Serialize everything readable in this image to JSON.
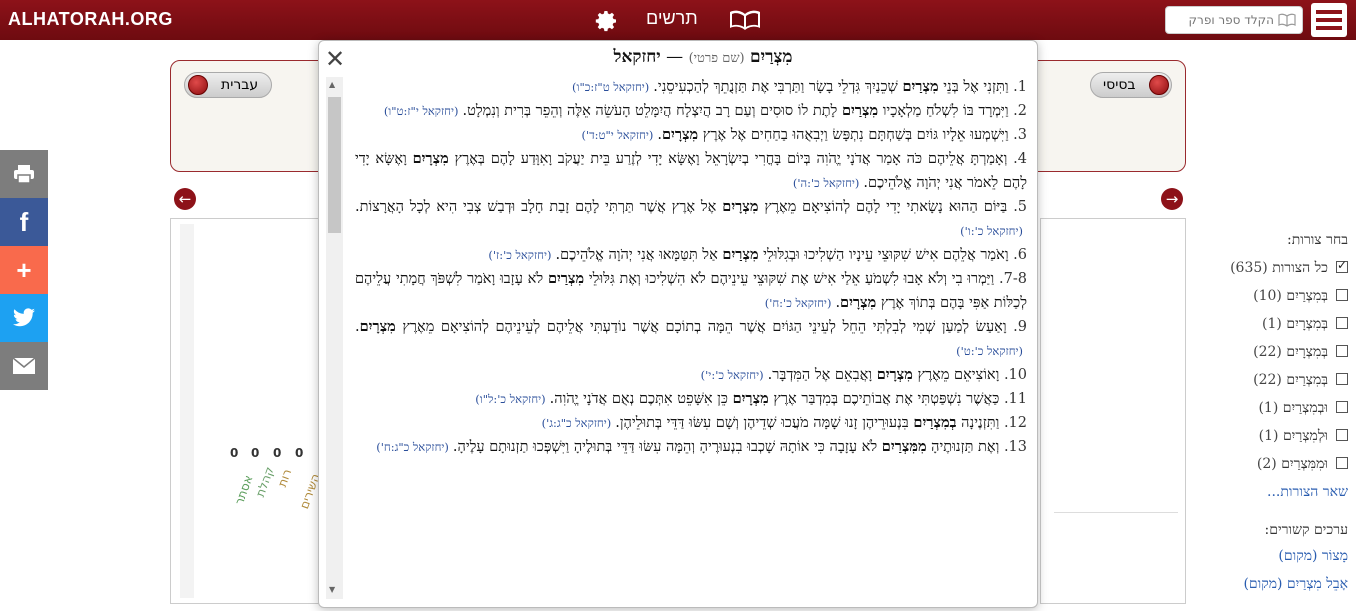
{
  "header": {
    "logo": "ALHATORAH.ORG",
    "nav_title": "תרשים",
    "search_placeholder": "הקלד ספר ופרק",
    "icons": [
      "gear-icon",
      "book-icon",
      "menu-icon"
    ]
  },
  "share": [
    "print-icon",
    "facebook-icon",
    "plus-icon",
    "twitter-icon",
    "email-icon"
  ],
  "toggles": {
    "left": "עברית",
    "right": "בסיסי"
  },
  "left_counts": [
    "0",
    "0",
    "0",
    "0"
  ],
  "left_labels": [
    "אסתר",
    "קהלת",
    "רות",
    "השירים"
  ],
  "forms": {
    "title": "בחר צורות:",
    "items": [
      {
        "label": "כל הצורות",
        "count": "(635)",
        "checked": true
      },
      {
        "label": "בְּמִצְרַיִם",
        "count": "(10)",
        "checked": false
      },
      {
        "label": "בְּמִצְרָיִם",
        "count": "(1)",
        "checked": false
      },
      {
        "label": "בְּמִצְרָיִם",
        "count": "(22)",
        "checked": false
      },
      {
        "label": "בְּמִצְרַיִם",
        "count": "(22)",
        "checked": false
      },
      {
        "label": "וּבְמִצְרַיִם",
        "count": "(1)",
        "checked": false
      },
      {
        "label": "וּלְמִצְרַיִם",
        "count": "(1)",
        "checked": false
      },
      {
        "label": "וּמִמִּצְרַיִם",
        "count": "(2)",
        "checked": false
      }
    ],
    "more": "שאר הצורות..."
  },
  "related": {
    "title": "ערכים קשורים:",
    "items": [
      "מָצוֹר (מקום)",
      "אָבֵל מִצְרַיִם (מקום)"
    ]
  },
  "modal": {
    "title_word": "מִצְרַיִם",
    "title_sub": "(שם פרטי)",
    "title_dash": "—",
    "title_book": "יחזקאל",
    "verses": [
      {
        "num": "1.",
        "pre": "וַתִּזְנִי אֶל בְּנֵי ",
        "bold": "מִצְרַיִם",
        "post": " שְׁכֵנַיִךְ גִּדְלֵי בָשָׂר וַתַּרְבִּי אֶת תַּזְנֻתֵךְ לְהַכְעִיסֵנִי.",
        "ref": "(יחזקאל ט\"ז:כ\"ו)"
      },
      {
        "num": "2.",
        "pre": "וַיִּמְרָד בּוֹ לִשְׁלֹחַ מַלְאָכָיו ",
        "bold": "מִצְרַיִם",
        "post": " לָתֶת לוֹ סוּסִים וְעַם רָב הֲיִצְלָח הֲיִמָּלֵט הָעֹשֵׂה אֵלֶּה וְהֵפֵר בְּרִית וְנִמְלָט.",
        "ref": "(יחזקאל י\"ז:ט\"ו)"
      },
      {
        "num": "3.",
        "pre": "וַיִּשְׁמְעוּ אֵלָיו גּוֹיִם בְּשַׁחְתָּם נִתְפָּשׂ וַיְבִאֻהוּ בַחַחִים אֶל אֶרֶץ ",
        "bold": "מִצְרָיִם",
        "post": ".",
        "ref": "(יחזקאל י\"ט:ד')"
      },
      {
        "num": "4.",
        "pre": "וְאָמַרְתָּ אֲלֵיהֶם כֹּה אָמַר אֲדֹנָי יֱהֹוִה בְּיוֹם בָּחֳרִי בְיִשְׂרָאֵל וָאֶשָּׂא יָדִי לְזֶרַע בֵּית יַעֲקֹב וָאִוָּדַע לָהֶם בְּאֶרֶץ ",
        "bold": "מִצְרָיִם",
        "post": " וָאֶשָּׂא יָדִי לָהֶם לֵאמֹר אֲנִי יְהֹוָה אֱלֹהֵיכֶם.",
        "ref": "(יחזקאל כ':ה')"
      },
      {
        "num": "5.",
        "pre": "בַּיּוֹם הַהוּא נָשָׂאתִי יָדִי לָהֶם לְהוֹצִיאָם מֵאֶרֶץ ",
        "bold": "מִצְרָיִם",
        "post": " אֶל אֶרֶץ אֲשֶׁר תַּרְתִּי לָהֶם זָבַת חָלָב וּדְבַשׁ צְבִי הִיא לְכָל הָאֲרָצוֹת.",
        "ref": "(יחזקאל כ':ו')"
      },
      {
        "num": "6.",
        "pre": "וָאֹמַר אֲלֵהֶם אִישׁ שִׁקּוּצֵי עֵינָיו הַשְׁלִיכוּ וּבְגִלּוּלֵי ",
        "bold": "מִצְרַיִם",
        "post": " אַל תִּטַּמָּאוּ אֲנִי יְהֹוָה אֱלֹהֵיכֶם.",
        "ref": "(יחזקאל כ':ז')"
      },
      {
        "num": "7-8.",
        "pre": "וַיַּמְרוּ בִי וְלֹא אָבוּ לִשְׁמֹעַ אֵלַי אִישׁ אֶת שִׁקּוּצֵי עֵינֵיהֶם לֹא הִשְׁלִיכוּ וְאֶת גִּלּוּלֵי ",
        "bold": "מִצְרַיִם",
        "post": " לֹא עָזָבוּ וָאֹמַר לִשְׁפֹּךְ חֲמָתִי עֲלֵיהֶם לְכַלּוֹת אַפִּי בָּהֶם בְּתוֹךְ אֶרֶץ ",
        "bold2": "מִצְרָיִם",
        "post2": ".",
        "ref": "(יחזקאל כ':ח')"
      },
      {
        "num": "9.",
        "pre": "וָאַעַשׂ לְמַעַן שְׁמִי לְבִלְתִּי הֵחֵל לְעֵינֵי הַגּוֹיִם אֲשֶׁר הֵמָּה בְתוֹכָם אֲשֶׁר נוֹדַעְתִּי אֲלֵיהֶם לְעֵינֵיהֶם לְהוֹצִיאָם מֵאֶרֶץ ",
        "bold": "מִצְרָיִם",
        "post": ".",
        "ref": "(יחזקאל כ':ט')"
      },
      {
        "num": "10.",
        "pre": "וָאוֹצִיאֵם מֵאֶרֶץ ",
        "bold": "מִצְרָיִם",
        "post": " וָאֲבִאֵם אֶל הַמִּדְבָּר.",
        "ref": "(יחזקאל כ':י')"
      },
      {
        "num": "11.",
        "pre": "כַּאֲשֶׁר נִשְׁפַּטְתִּי אֶת אֲבוֹתֵיכֶם בְּמִדְבַּר אֶרֶץ ",
        "bold": "מִצְרָיִם",
        "post": " כֵּן אִשָּׁפֵט אִתְּכֶם נְאֻם אֲדֹנָי יֱהֹוִה.",
        "ref": "(יחזקאל כ':ל\"ו)"
      },
      {
        "num": "12.",
        "pre": "וַתִּזְנֶינָה ",
        "bold": "בְמִצְרַיִם",
        "post": " בִּנְעוּרֵיהֶן זָנוּ שָׁמָּה מֹעֲכוּ שְׁדֵיהֶן וְשָׁם עִשּׂוּ דַּדֵּי בְּתוּלֵיהֶן.",
        "ref": "(יחזקאל כ\"ג:ג')"
      },
      {
        "num": "13.",
        "pre": "וְאֶת תַּזְנוּתֶיהָ ",
        "bold": "מִמִּצְרַיִם",
        "post": " לֹא עָזָבָה כִּי אוֹתָהּ שָׁכְבוּ בִנְעוּרֶיהָ וְהֵמָּה עִשּׂוּ דַּדֵּי בְּתוּלֶיהָ וַיִּשְׁפְּכוּ תַזְנוּתָם עָלֶיהָ.",
        "ref": "(יחזקאל כ\"ג:ח')"
      }
    ]
  }
}
